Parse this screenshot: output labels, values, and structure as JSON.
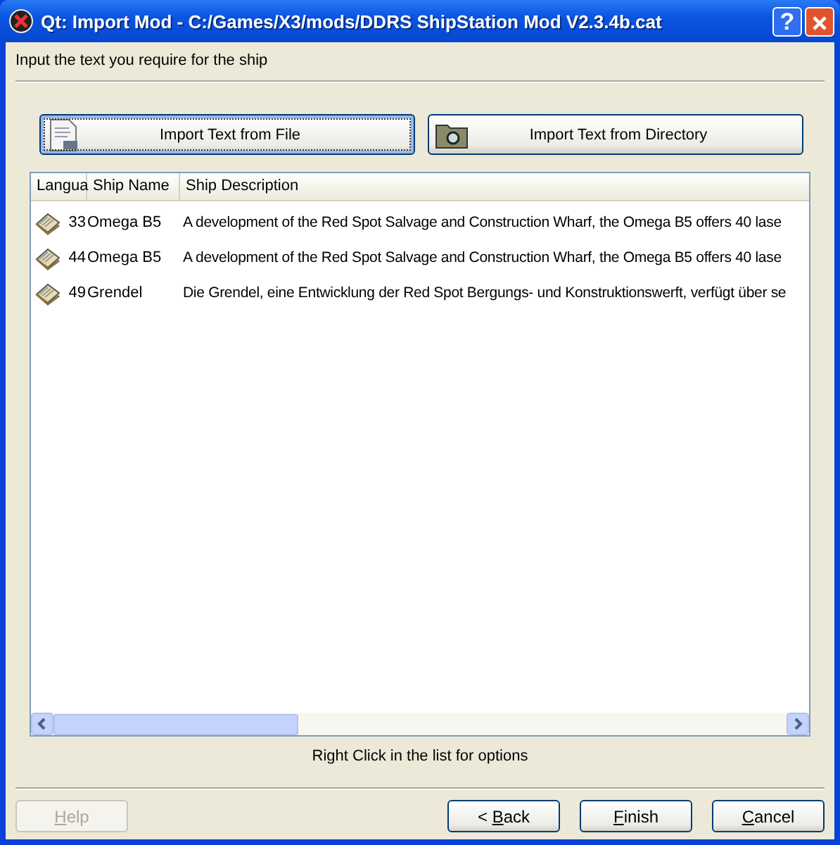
{
  "window": {
    "title": "Qt: Import Mod - C:/Games/X3/mods/DDRS ShipStation Mod V2.3.4b.cat",
    "help_glyph": "?"
  },
  "instruction": "Input the text you require for the ship",
  "import_buttons": [
    {
      "label": "Import Text from File",
      "kind": "file",
      "focused": true
    },
    {
      "label": "Import Text from Directory",
      "kind": "folder",
      "focused": false
    }
  ],
  "table": {
    "columns": [
      "Langua",
      "Ship Name",
      "Ship Description"
    ],
    "rows": [
      {
        "language": "33",
        "name": "Omega B5",
        "description": "A development of the Red Spot Salvage and Construction Wharf, the Omega B5 offers 40 lase"
      },
      {
        "language": "44",
        "name": "Omega B5",
        "description": "A development of the Red Spot Salvage and Construction Wharf, the Omega B5 offers 40 lase"
      },
      {
        "language": "49",
        "name": "Grendel",
        "description": "Die Grendel, eine Entwicklung der Red Spot Bergungs- und Konstruktionswerft, verfügt über se"
      }
    ]
  },
  "hint": "Right Click in the list for options",
  "footer_buttons": [
    {
      "key": "H",
      "after": "elp",
      "disabled": true
    },
    {
      "before": "< ",
      "key": "B",
      "after": "ack",
      "disabled": false
    },
    {
      "key": "F",
      "after": "inish",
      "disabled": false
    },
    {
      "key": "C",
      "after": "ancel",
      "disabled": false
    }
  ]
}
